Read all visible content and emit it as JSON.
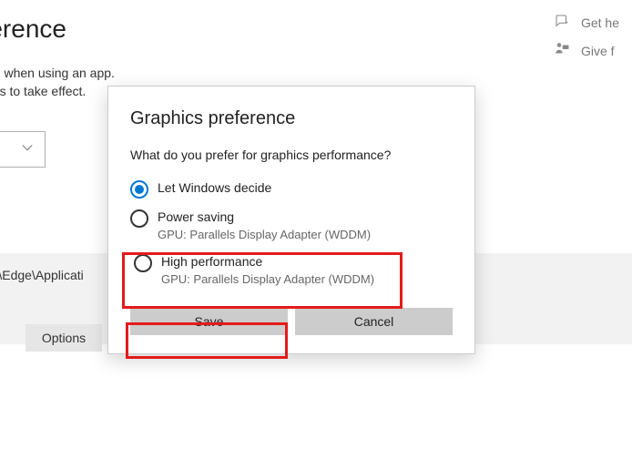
{
  "background": {
    "title": "eference",
    "desc1": "e or battery life when using an app.",
    "desc2": "r your changes to take effect.",
    "app_path": "osoft\\Edge\\Applicati",
    "options_button": "Options"
  },
  "header": {
    "get_help": "Get he",
    "give_feedback": "Give f"
  },
  "dialog": {
    "title": "Graphics preference",
    "question": "What do you prefer for graphics performance?",
    "options": [
      {
        "label": "Let Windows decide",
        "sub": "",
        "selected": true
      },
      {
        "label": "Power saving",
        "sub": "GPU: Parallels Display Adapter (WDDM)",
        "selected": false
      },
      {
        "label": "High performance",
        "sub": "GPU: Parallels Display Adapter (WDDM)",
        "selected": false
      }
    ],
    "save_label": "Save",
    "cancel_label": "Cancel"
  }
}
